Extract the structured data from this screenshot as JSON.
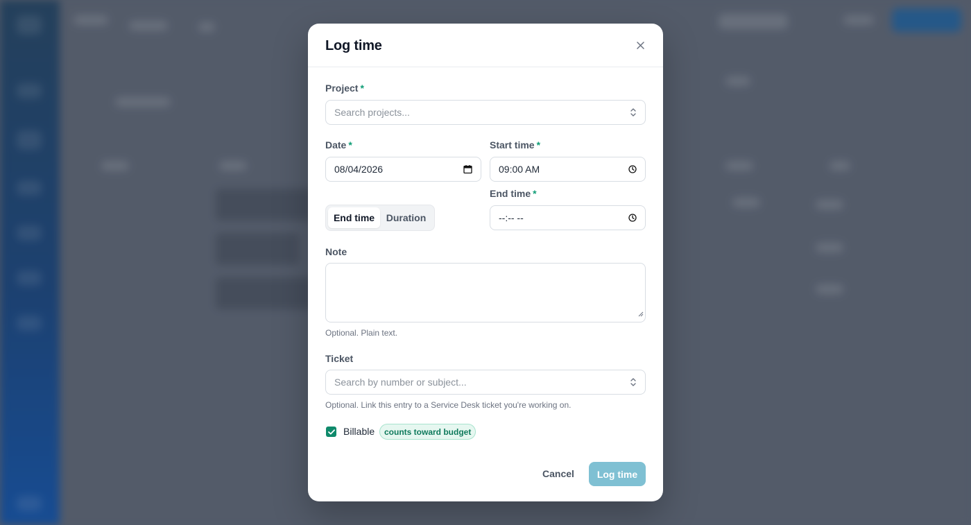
{
  "modal": {
    "title": "Log time",
    "project": {
      "label": "Project",
      "required_mark": "*",
      "placeholder": "Search projects..."
    },
    "date": {
      "label": "Date",
      "required_mark": "*",
      "value": "08/04/2026"
    },
    "start_time": {
      "label": "Start time",
      "required_mark": "*",
      "value": "09:00 AM"
    },
    "end_time": {
      "label": "End time",
      "required_mark": "*",
      "value": "--:-- --"
    },
    "mode_toggle": {
      "options": [
        "End time",
        "Duration"
      ],
      "selected": "End time"
    },
    "note": {
      "label": "Note",
      "value": "",
      "hint": "Optional. Plain text."
    },
    "ticket": {
      "label": "Ticket",
      "placeholder": "Search by number or subject...",
      "hint": "Optional. Link this entry to a Service Desk ticket you're working on."
    },
    "billable": {
      "label": "Billable",
      "checked": true,
      "badge": "counts toward budget"
    },
    "actions": {
      "cancel": "Cancel",
      "submit": "Log time"
    }
  },
  "colors": {
    "accent": "#0f8a6b",
    "primary_button": "#7fc0d3",
    "required": "#0f9d76"
  },
  "icons": [
    "close-icon",
    "chevron-updown-icon",
    "calendar-icon",
    "clock-icon",
    "check-icon",
    "resize-handle-icon"
  ]
}
